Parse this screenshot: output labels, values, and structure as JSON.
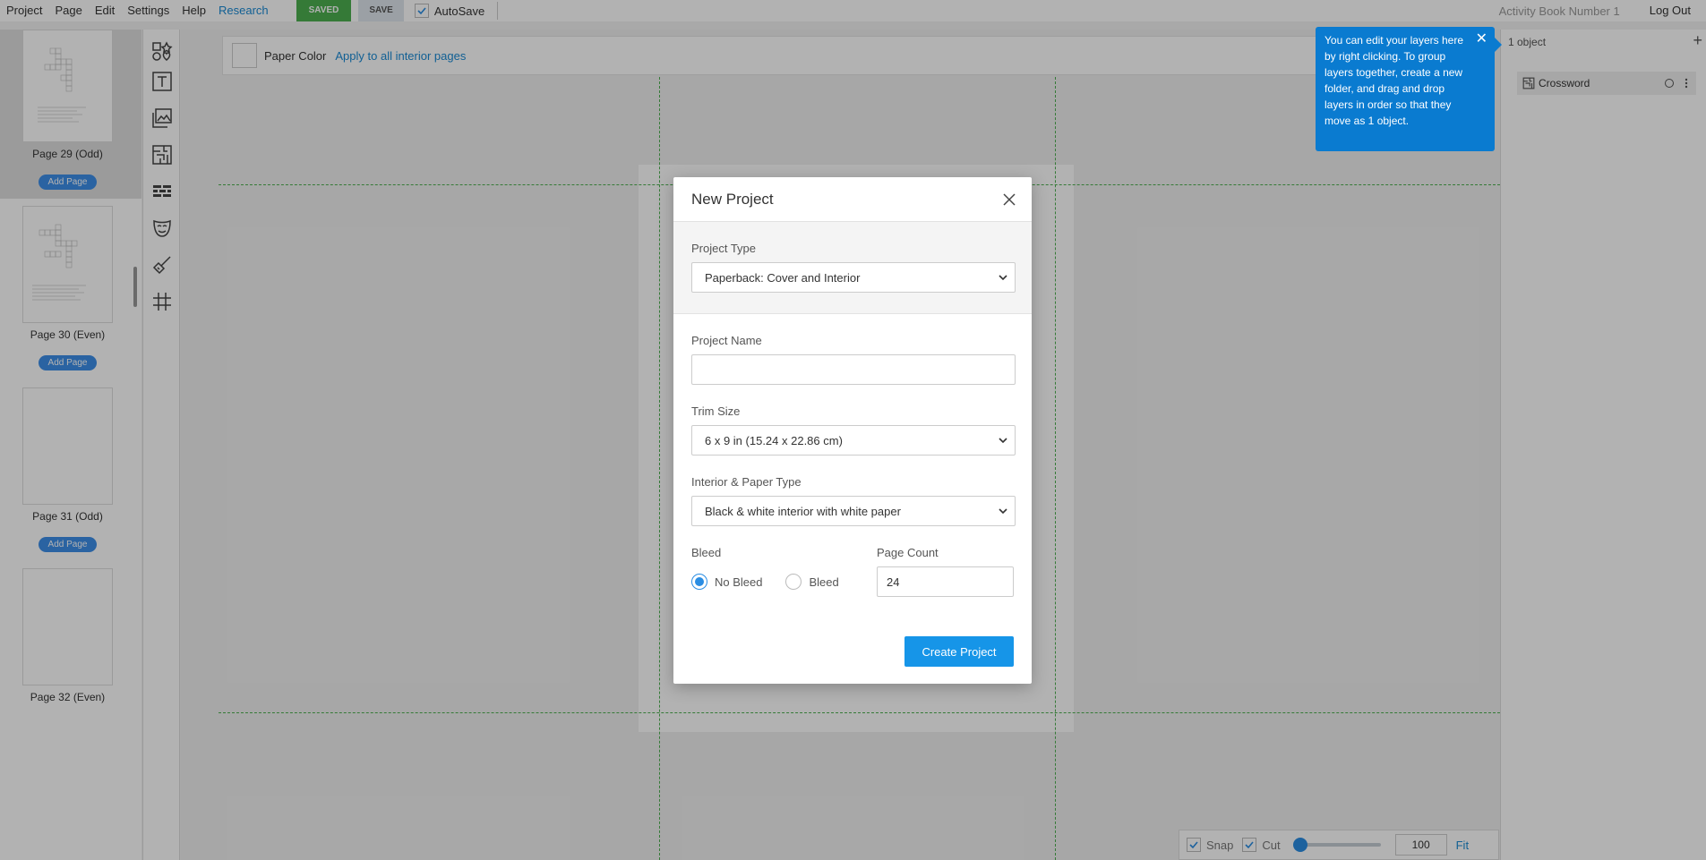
{
  "menu": {
    "items": [
      "Project",
      "Page",
      "Edit",
      "Settings",
      "Help"
    ],
    "research": "Research",
    "saved_badge": "SAVED",
    "save_button": "SAVE",
    "autosave_label": "AutoSave",
    "document_title": "Activity Book Number 1",
    "logout": "Log Out"
  },
  "pages_panel": {
    "pages": [
      {
        "label": "Page 29 (Odd)",
        "add": "Add Page",
        "has_puzzle": true
      },
      {
        "label": "Page 30 (Even)",
        "add": "Add Page",
        "has_puzzle": true
      },
      {
        "label": "Page 31 (Odd)",
        "add": "Add Page",
        "has_puzzle": false
      },
      {
        "label": "Page 32 (Even)",
        "add": null,
        "has_puzzle": false
      }
    ]
  },
  "tools": [
    "shapes-icon",
    "text-icon",
    "image-icon",
    "maze-icon",
    "brick-icon",
    "mask-icon",
    "brush-icon",
    "grid-icon"
  ],
  "toolbar": {
    "paper_color_label": "Paper Color",
    "apply_link": "Apply to all interior pages"
  },
  "layers_panel": {
    "count": "1 object",
    "layers": [
      {
        "name": "Crossword",
        "icon": "maze-icon"
      }
    ]
  },
  "zoom": {
    "snap_label": "Snap",
    "cut_label": "Cut",
    "value": "100",
    "fit": "Fit"
  },
  "tooltip": {
    "text": "You can edit your layers here by right clicking. To group layers together, create a new folder, and drag and drop layers in order so that they move as 1 object."
  },
  "modal": {
    "title": "New Project",
    "project_type_label": "Project Type",
    "project_type_value": "Paperback: Cover and Interior",
    "project_name_label": "Project Name",
    "project_name_value": "",
    "trim_size_label": "Trim Size",
    "trim_size_value": "6 x 9 in (15.24 x 22.86 cm)",
    "interior_label": "Interior & Paper Type",
    "interior_value": "Black & white interior with white paper",
    "bleed_label": "Bleed",
    "no_bleed": "No Bleed",
    "bleed": "Bleed",
    "bleed_selected": "No Bleed",
    "page_count_label": "Page Count",
    "page_count_value": "24",
    "create_button": "Create Project"
  },
  "colors": {
    "accent": "#1695e8",
    "saved_green": "#4caf50",
    "tooltip_blue": "#0a7bd0",
    "guide_green": "#4caf50"
  }
}
